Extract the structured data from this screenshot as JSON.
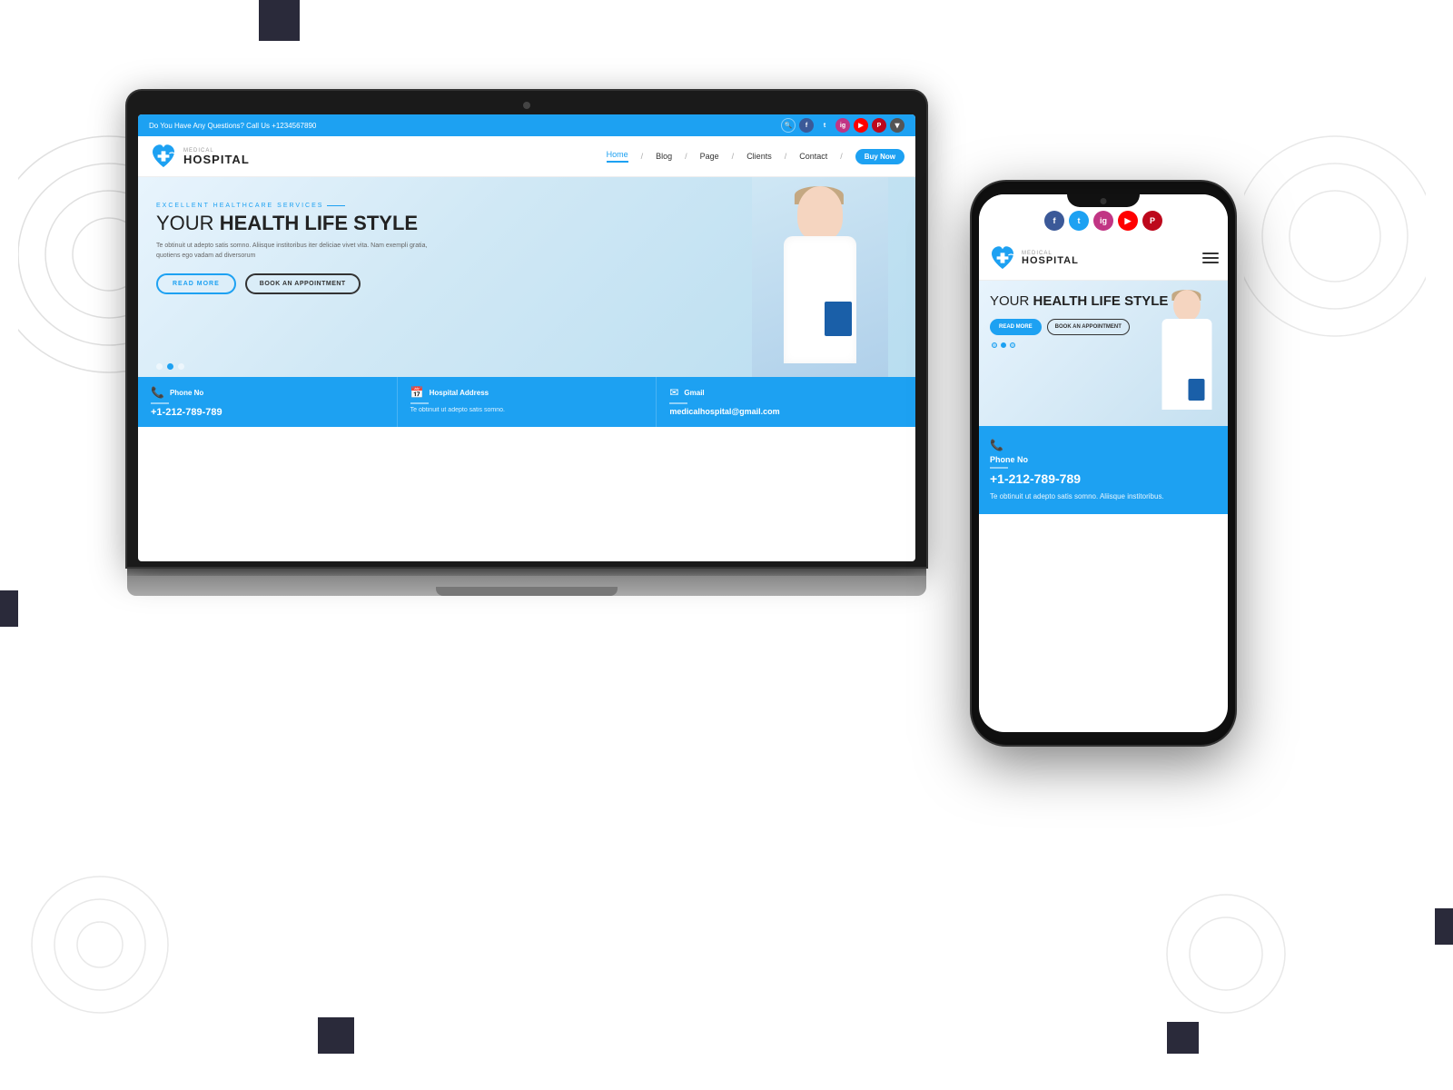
{
  "background": "#ffffff",
  "decorative_squares": [
    {
      "pos": "top-center",
      "size": "45x45"
    },
    {
      "pos": "mid-right",
      "size": "30x30"
    },
    {
      "pos": "mid-left",
      "size": "20x40"
    },
    {
      "pos": "mid-right-lower",
      "size": "20x40"
    },
    {
      "pos": "bottom-left",
      "size": "40x40"
    },
    {
      "pos": "bottom-right",
      "size": "35x35"
    }
  ],
  "laptop": {
    "topbar": {
      "phone_text": "Do You Have Any Questions? Call Us +1234567890",
      "social": [
        "search",
        "facebook",
        "twitter",
        "instagram",
        "youtube",
        "pinterest"
      ]
    },
    "nav": {
      "logo_medical": "MEDICAL",
      "logo_hospital": "HOSPITAL",
      "links": [
        "Home",
        "Blog",
        "Page",
        "Clients",
        "Contact"
      ],
      "cta": "Buy Now"
    },
    "hero": {
      "subtitle": "EXCELLENT HEALTHCARE SERVICES",
      "title_light": "YOUR ",
      "title_bold": "HEALTH LIFE STYLE",
      "description": "Te obtinuit ut adepto satis somno. Aliisque institoribus iter deliciae vivet vita.\nNam exempli gratia, quotiens ego vadam ad diversorum",
      "btn_read": "READ MORE",
      "btn_appt": "BOOK AN APPOINTMENT",
      "dots": [
        1,
        2,
        3
      ],
      "active_dot": 2
    },
    "contact_bar": {
      "phone": {
        "icon": "📞",
        "label": "Phone No",
        "value": "+1-212-789-789"
      },
      "address": {
        "icon": "📅",
        "label": "Hospital Address",
        "subtext": "Te obtinuit ut adepto satis somno."
      },
      "gmail": {
        "icon": "✉",
        "label": "Gmail",
        "value": "medicalhospital@gmail.com"
      }
    }
  },
  "phone": {
    "social": [
      "facebook",
      "twitter",
      "instagram",
      "youtube",
      "pinterest"
    ],
    "nav": {
      "logo_medical": "MEDICAL",
      "logo_hospital": "HOSPITAL",
      "hamburger": true
    },
    "hero": {
      "title_light": "YOUR ",
      "title_bold": "HEALTH LIFE STYLE",
      "btn_read": "READ MORE",
      "btn_appt": "BOOK AN APPOINTMENT",
      "active_dot": 2
    },
    "contact": {
      "phone_label": "Phone No",
      "phone_value": "+1-212-789-789",
      "desc": "Te obtinuit ut adepto satis somno. Aliisque institoribus."
    }
  }
}
